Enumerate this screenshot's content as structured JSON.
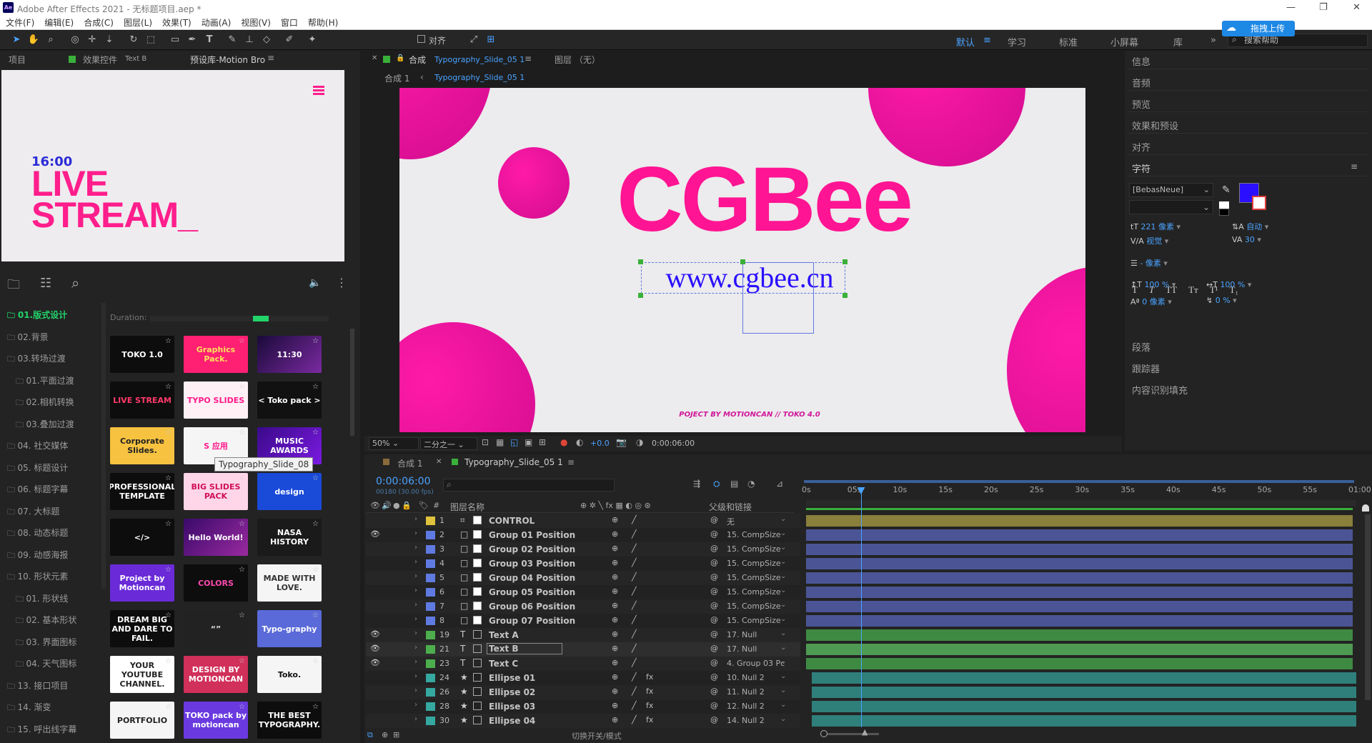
{
  "app": {
    "title": "Adobe After Effects 2021 - 无标题项目.aep *",
    "icon_text": "Ae"
  },
  "menu": [
    "文件(F)",
    "编辑(E)",
    "合成(C)",
    "图层(L)",
    "效果(T)",
    "动画(A)",
    "视图(V)",
    "窗口",
    "帮助(H)"
  ],
  "toolbar": {
    "align_label": "对齐",
    "upload_button": "拖拽上传",
    "search_help": "搜索帮助"
  },
  "workspaces": [
    "默认",
    "学习",
    "标准",
    "小屏幕",
    "库"
  ],
  "left_panel": {
    "tabs": [
      "项目",
      "效果控件",
      "Text B",
      "预设库-Motion Bro"
    ],
    "preview": {
      "time": "16:00",
      "line1": "LIVE",
      "line2": "STREAM_"
    },
    "duration_label": "Duration:",
    "categories": [
      "01.版式设计",
      "02.背景",
      "03.转场过渡",
      "01.平面过渡",
      "02.相机转换",
      "03.叠加过渡",
      "04. 社交媒体",
      "05. 标题设计",
      "06. 标题字幕",
      "07. 大标题",
      "08. 动态标题",
      "09. 动感海报",
      "10. 形状元素",
      "01. 形状线",
      "02. 基本形状",
      "03. 界面图标",
      "04. 天气图标",
      "13. 接口项目",
      "14. 渐变",
      "15. 呼出线字幕"
    ],
    "tooltip": "Typography_Slide_08",
    "thumbs": [
      "TOKO 1.0",
      "Graphics Pack.",
      "11:30",
      "LIVE STREAM",
      "TYPO SLIDES",
      "< Toko pack >",
      "Corporate Slides.",
      "S 应用",
      "MUSIC AWARDS",
      "PROFESSIONAL TEMPLATE",
      "BIG SLIDES PACK",
      "design",
      "</>",
      "Hello World!",
      "NASA HISTORY",
      "Project by Motioncan",
      "COLORS",
      "MADE WITH LOVE.",
      "DREAM BIG AND DARE TO FAIL.",
      "“”",
      "Typo-graphy",
      "YOUR YOUTUBE CHANNEL.",
      "DESIGN BY MOTIONCAN",
      "Toko.",
      "PORTFOLIO",
      "TOKO pack by motioncan",
      "THE BEST TYPOGRAPHY."
    ]
  },
  "viewer": {
    "tab_comp": "合成",
    "comp_name": "Typography_Slide_05 1",
    "layer_tab": "图层 （无）",
    "breadcrumb1": "合成 1",
    "breadcrumb2": "Typography_Slide_05 1",
    "main_text": "CGBee",
    "url_text": "www.cgbee.cn",
    "credit": "POJECT BY MOTIONCAN // TOKO 4.0",
    "zoom": "50%",
    "resolution": "二分之一",
    "exposure": "+0.0",
    "timecode": "0:00:06:00"
  },
  "right_panel": {
    "sections": [
      "信息",
      "音频",
      "预览",
      "效果和预设",
      "对齐",
      "字符"
    ],
    "sections_bottom": [
      "段落",
      "跟踪器",
      "内容识别填充"
    ],
    "font": "[BebasNeue]",
    "size": "221 像素",
    "leading": "自动",
    "kerning": "视觉",
    "tracking": "30",
    "stroke": "- 像素",
    "vscale": "100 %",
    "hscale": "100 %",
    "baseline": "0 像素",
    "tsume": "0 %",
    "fill_color": "#2a10ff"
  },
  "timeline": {
    "tabs": [
      "合成 1",
      "Typography_Slide_05 1"
    ],
    "timecode": "0:00:06:00",
    "fps": "00180 (30.00 fps)",
    "col_name": "图层名称",
    "col_parent": "父级和链接",
    "toggle_label": "切换开关/模式",
    "ruler": [
      "0s",
      "05s",
      "10s",
      "15s",
      "20s",
      "25s",
      "30s",
      "35s",
      "40s",
      "45s",
      "50s",
      "55s",
      "01:00"
    ],
    "playhead_sec": 6,
    "layers": [
      {
        "num": "1",
        "name": "CONTROL",
        "parent": "无",
        "color": "#e0c23c",
        "vis": false,
        "type": "shape",
        "bar": "#8a7f3b"
      },
      {
        "num": "2",
        "name": "Group 01 Position",
        "parent": "15. CompSize",
        "color": "#5f7ae0",
        "vis": true,
        "type": "box",
        "bar": "#4b5596"
      },
      {
        "num": "3",
        "name": "Group 02 Position",
        "parent": "15. CompSize",
        "color": "#5f7ae0",
        "vis": false,
        "type": "box",
        "bar": "#4b5596"
      },
      {
        "num": "4",
        "name": "Group 03 Position",
        "parent": "15. CompSize",
        "color": "#5f7ae0",
        "vis": false,
        "type": "box",
        "bar": "#4b5596"
      },
      {
        "num": "5",
        "name": "Group 04 Position",
        "parent": "15. CompSize",
        "color": "#5f7ae0",
        "vis": false,
        "type": "box",
        "bar": "#4b5596"
      },
      {
        "num": "6",
        "name": "Group 05 Position",
        "parent": "15. CompSize",
        "color": "#5f7ae0",
        "vis": false,
        "type": "box",
        "bar": "#4b5596"
      },
      {
        "num": "7",
        "name": "Group 06 Position",
        "parent": "15. CompSize",
        "color": "#5f7ae0",
        "vis": false,
        "type": "box",
        "bar": "#4b5596"
      },
      {
        "num": "8",
        "name": "Group 07 Position",
        "parent": "15. CompSize",
        "color": "#5f7ae0",
        "vis": false,
        "type": "box",
        "bar": "#4b5596"
      },
      {
        "num": "19",
        "name": "Text A",
        "parent": "17. Null",
        "color": "#4cae4c",
        "vis": true,
        "type": "T",
        "bar": "#3f8a43"
      },
      {
        "num": "21",
        "name": "Text B",
        "parent": "17. Null",
        "color": "#4cae4c",
        "vis": true,
        "type": "T",
        "bar": "#4f9a53"
      },
      {
        "num": "23",
        "name": "Text C",
        "parent": "4. Group 03 Pc",
        "color": "#4cae4c",
        "vis": true,
        "type": "T",
        "bar": "#3f8a43"
      },
      {
        "num": "24",
        "name": "Ellipse 01",
        "parent": "10. Null 2",
        "color": "#35a8a0",
        "vis": false,
        "type": "star",
        "bar": "#2f7f7a"
      },
      {
        "num": "26",
        "name": "Ellipse 02",
        "parent": "11. Null 2",
        "color": "#35a8a0",
        "vis": false,
        "type": "star",
        "bar": "#2f7f7a"
      },
      {
        "num": "28",
        "name": "Ellipse 03",
        "parent": "12. Null 2",
        "color": "#35a8a0",
        "vis": false,
        "type": "star",
        "bar": "#2f7f7a"
      },
      {
        "num": "30",
        "name": "Ellipse 04",
        "parent": "14. Null 2",
        "color": "#35a8a0",
        "vis": false,
        "type": "star",
        "bar": "#2f7f7a"
      }
    ]
  }
}
